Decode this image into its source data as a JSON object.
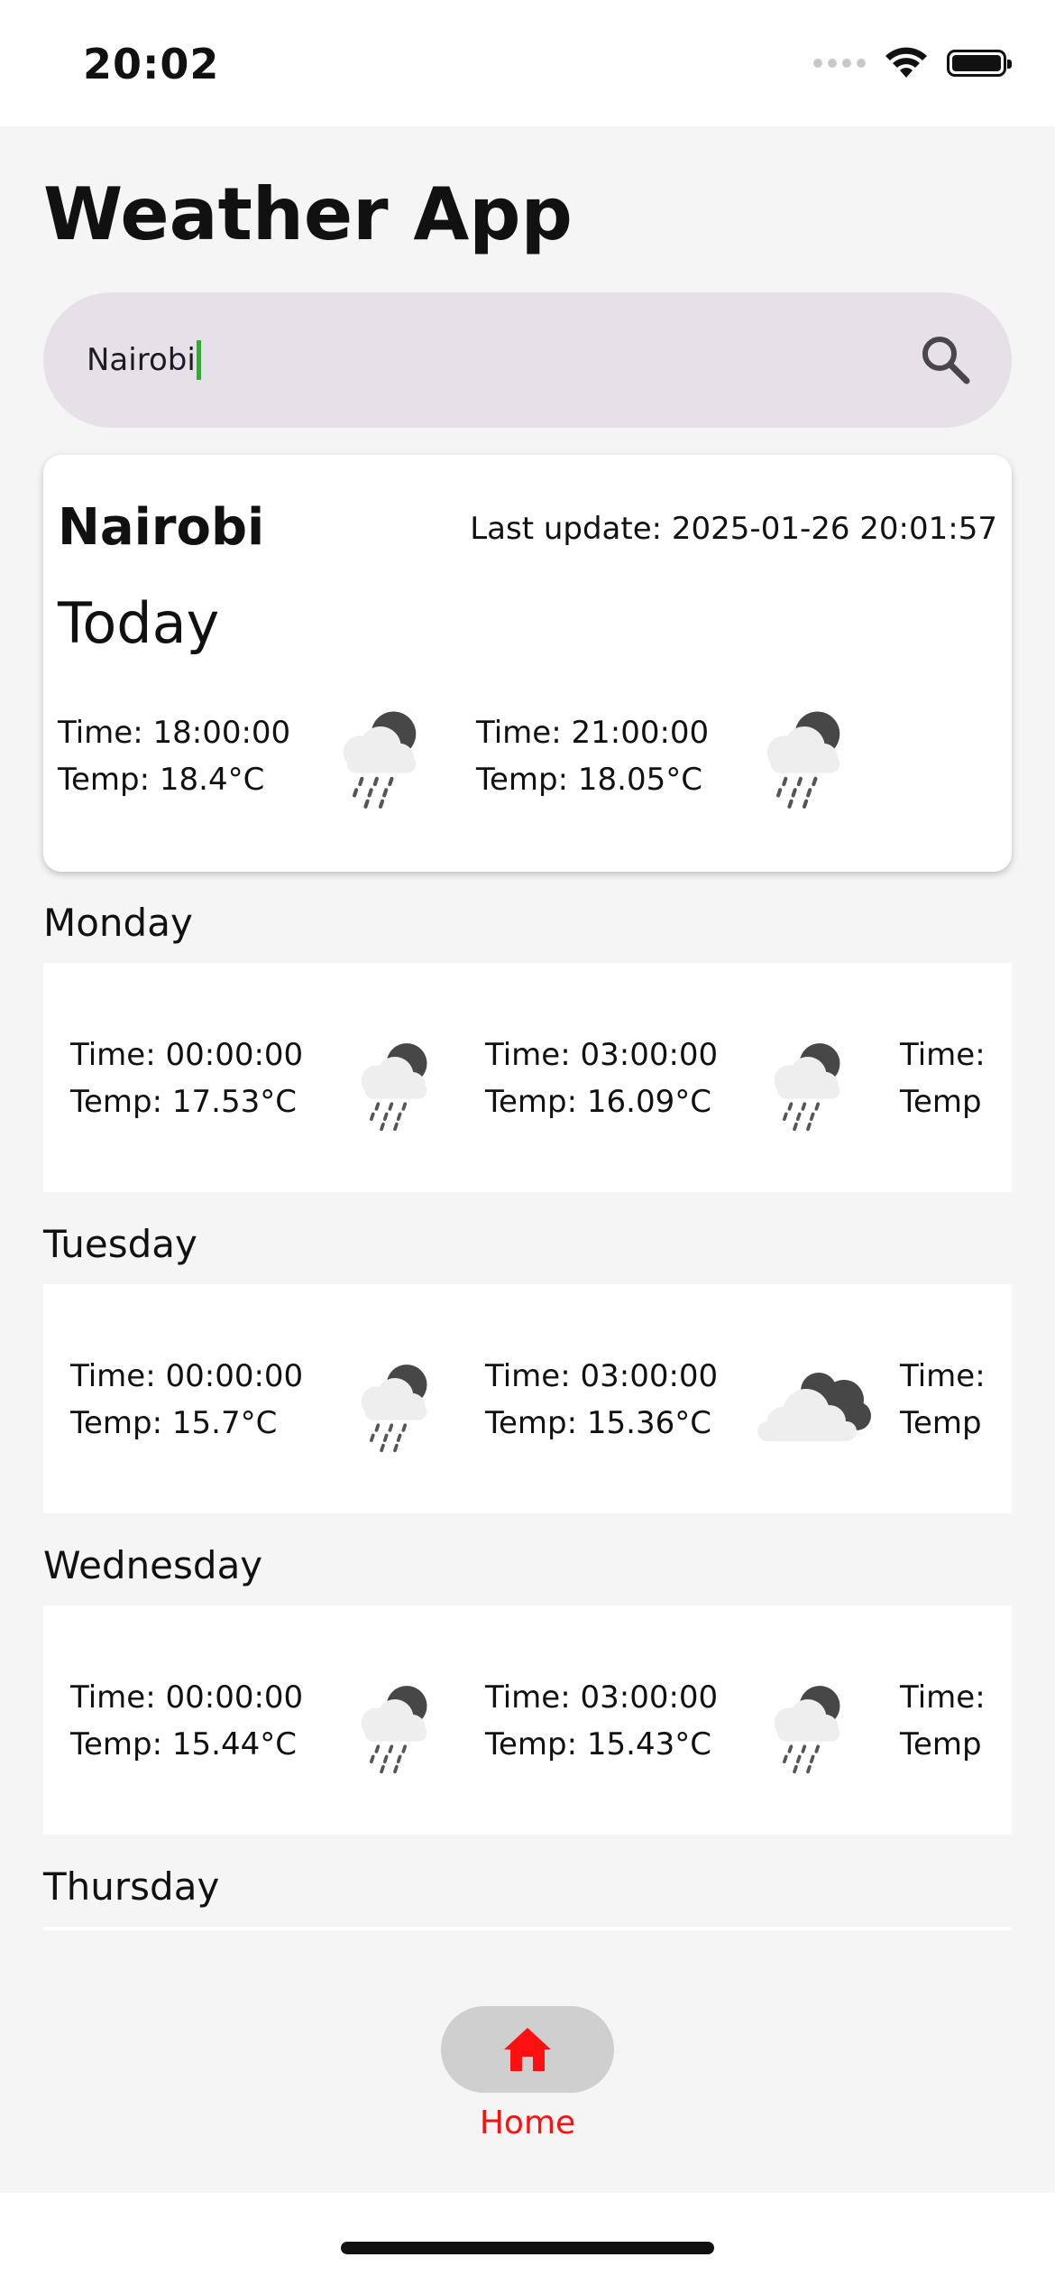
{
  "status_bar": {
    "time": "20:02"
  },
  "app": {
    "title": "Weather App"
  },
  "search": {
    "value": "Nairobi"
  },
  "today": {
    "city": "Nairobi",
    "last_update": "Last update: 2025-01-26 20:01:57",
    "label": "Today",
    "slots": [
      {
        "time": "Time: 18:00:00",
        "temp": "Temp: 18.4°C",
        "icon": "rain-night-icon"
      },
      {
        "time": "Time: 21:00:00",
        "temp": "Temp: 18.05°C",
        "icon": "rain-night-icon"
      }
    ]
  },
  "days": [
    {
      "name": "Monday",
      "slots": [
        {
          "time": "Time: 00:00:00",
          "temp": "Temp: 17.53°C",
          "icon": "rain-night-icon"
        },
        {
          "time": "Time: 03:00:00",
          "temp": "Temp: 16.09°C",
          "icon": "rain-night-icon"
        },
        {
          "time": "Time:",
          "temp": "Temp"
        }
      ]
    },
    {
      "name": "Tuesday",
      "slots": [
        {
          "time": "Time: 00:00:00",
          "temp": "Temp: 15.7°C",
          "icon": "rain-night-icon"
        },
        {
          "time": "Time: 03:00:00",
          "temp": "Temp: 15.36°C",
          "icon": "cloudy-night-icon"
        },
        {
          "time": "Time:",
          "temp": "Temp"
        }
      ]
    },
    {
      "name": "Wednesday",
      "slots": [
        {
          "time": "Time: 00:00:00",
          "temp": "Temp: 15.44°C",
          "icon": "rain-night-icon"
        },
        {
          "time": "Time: 03:00:00",
          "temp": "Temp: 15.43°C",
          "icon": "rain-night-icon"
        },
        {
          "time": "Time:",
          "temp": "Temp"
        }
      ]
    },
    {
      "name": "Thursday"
    }
  ],
  "nav": {
    "home_label": "Home",
    "active_color": "#ff1010"
  }
}
